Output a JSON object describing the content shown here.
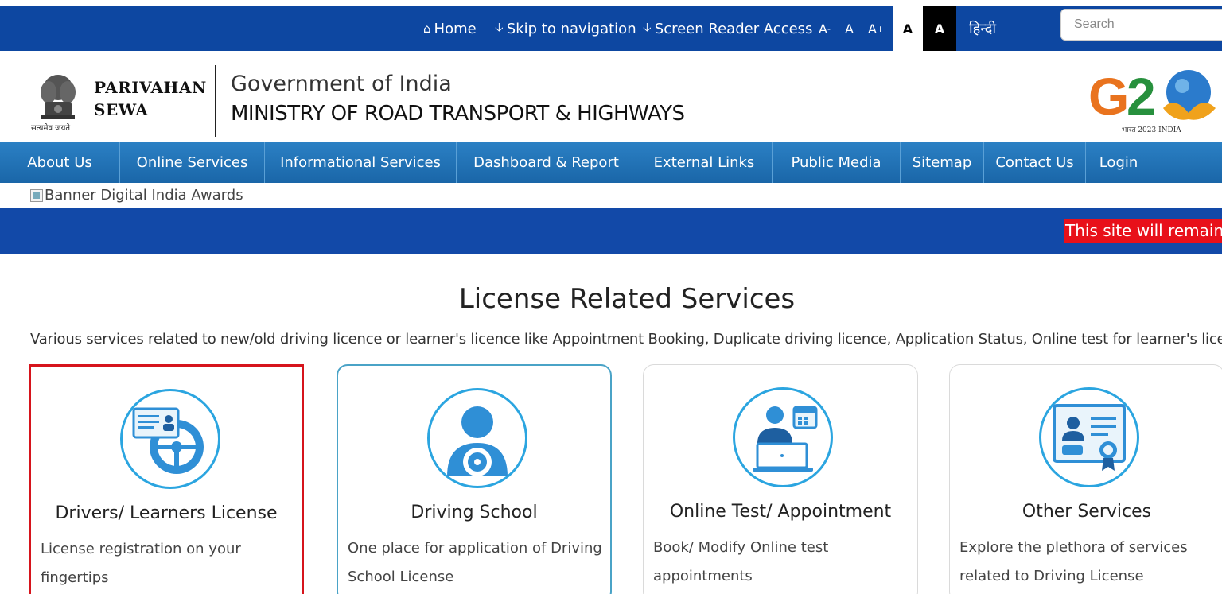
{
  "topbar": {
    "home": "Home",
    "skip_nav": "Skip to navigation",
    "screen_reader": "Screen Reader Access",
    "font_decrease": "A",
    "font_decrease_sup": "-",
    "font_normal": "A",
    "font_increase": "A",
    "font_increase_sup": "+",
    "contrast_light": "A",
    "contrast_dark": "A",
    "language": "हिन्दी",
    "search_placeholder": "Search"
  },
  "header": {
    "brand_line1": "PARIVAHAN",
    "brand_line2": "SEWA",
    "emblem_motto": "सत्यमेव जयते",
    "gov": "Government of India",
    "ministry": "MINISTRY OF ROAD TRANSPORT & HIGHWAYS",
    "g20_caption": "भारत 2023 INDIA"
  },
  "nav": {
    "items": [
      {
        "label": "About Us"
      },
      {
        "label": "Online Services"
      },
      {
        "label": "Informational Services"
      },
      {
        "label": "Dashboard & Report"
      },
      {
        "label": "External Links"
      },
      {
        "label": "Public Media"
      },
      {
        "label": "Sitemap"
      },
      {
        "label": "Contact Us"
      },
      {
        "label": "Login"
      }
    ]
  },
  "banner_alt": "Banner Digital India Awards",
  "ticker": "This site will remain c",
  "section": {
    "title": "License Related Services",
    "description": "Various services related to new/old driving licence or learner's licence like Appointment Booking, Duplicate driving licence, Application Status, Online test for learner's licence, etc."
  },
  "cards": [
    {
      "title": "Drivers/ Learners License",
      "desc": "License registration on your fingertips",
      "icon": "license-steering-icon"
    },
    {
      "title": "Driving School",
      "desc": "One place for application of Driving School License",
      "icon": "driver-icon"
    },
    {
      "title": "Online Test/ Appointment",
      "desc": "Book/ Modify Online test appointments",
      "icon": "online-test-icon"
    },
    {
      "title": "Other Services",
      "desc": "Explore the plethora of services related to Driving License",
      "icon": "certificate-icon"
    }
  ],
  "colors": {
    "topbar": "#0d47a1",
    "nav": "#1a66a8",
    "accent": "#2ba5e0",
    "ticker_bg": "#1249a8",
    "ticker_highlight": "#e8101a",
    "selected_border": "#d6141c"
  }
}
